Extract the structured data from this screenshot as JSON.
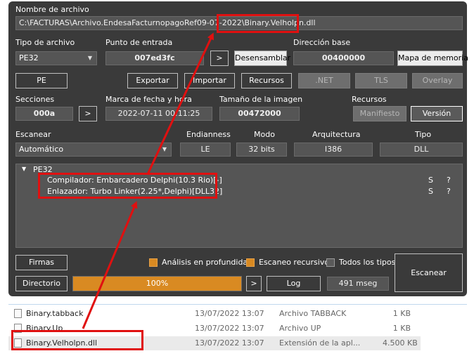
{
  "file_name": {
    "label": "Nombre de archivo",
    "path": "C:\\FACTURAS\\Archivo.EndesaFacturnopagoRef09-07-2022\\Binary.Velholpn.dll"
  },
  "file_type": {
    "label": "Tipo de archivo",
    "value": "PE32"
  },
  "entry_point": {
    "label": "Punto de entrada",
    "value": "007ed3fc",
    "arrow_btn": ">",
    "disasm_btn": "Desensamblar"
  },
  "base_address": {
    "label": "Dirección base",
    "value": "00400000",
    "memmap_btn": "Mapa de memoria"
  },
  "toolbar": {
    "pe": "PE",
    "export": "Exportar",
    "import": "Importar",
    "resources": "Recursos",
    "net": ".NET",
    "tls": "TLS",
    "overlay": "Overlay"
  },
  "sections": {
    "label": "Secciones",
    "value": "000a",
    "arrow_btn": ">"
  },
  "timestamp": {
    "label": "Marca de fecha y hora",
    "value": "2022-07-11 00:11:25"
  },
  "image_size": {
    "label": "Tamaño de la imagen",
    "value": "00472000"
  },
  "resources_group": {
    "label": "Recursos",
    "manifest_btn": "Manifiesto",
    "version_btn": "Versión"
  },
  "scan": {
    "label": "Escanear",
    "mode_value": "Automático"
  },
  "endianness": {
    "label": "Endianness",
    "value": "LE"
  },
  "mode": {
    "label": "Modo",
    "value": "32 bits"
  },
  "architecture": {
    "label": "Arquitectura",
    "value": "I386"
  },
  "type": {
    "label": "Tipo",
    "value": "DLL"
  },
  "results": {
    "root": "PE32",
    "items": [
      {
        "text": "Compilador: Embarcadero Delphi(10.3 Rio)[-]",
        "s": "S",
        "q": "?"
      },
      {
        "text": "Enlazador: Turbo Linker(2.25*,Delphi)[DLL32]",
        "s": "S",
        "q": "?"
      }
    ]
  },
  "bottom": {
    "signatures_btn": "Firmas",
    "deep_label": "Análisis en profundidad",
    "recursive_label": "Escaneo recursivo",
    "alltypes_label": "Todos los tipos",
    "scan_btn": "Escanear",
    "directory_btn": "Directorio",
    "progress_text": "100%",
    "progress_value": 1.0,
    "arrow_btn": ">",
    "log_btn": "Log",
    "elapsed": "491 mseg",
    "deep_checked": true,
    "recursive_checked": true,
    "alltypes_checked": false
  },
  "files": [
    {
      "name": "Binary.tabback",
      "date": "13/07/2022 13:07",
      "type": "Archivo TABBACK",
      "size": "1 KB"
    },
    {
      "name": "Binary.Up",
      "date": "13/07/2022 13:07",
      "type": "Archivo UP",
      "size": "1 KB"
    },
    {
      "name": "Binary.Velholpn.dll",
      "date": "13/07/2022 13:07",
      "type": "Extensión de la apl...",
      "size": "4.500 KB"
    }
  ],
  "colors": {
    "panel": "#3a3a3a",
    "field": "#555555",
    "accent": "#d98a22",
    "highlight": "#e01010"
  }
}
